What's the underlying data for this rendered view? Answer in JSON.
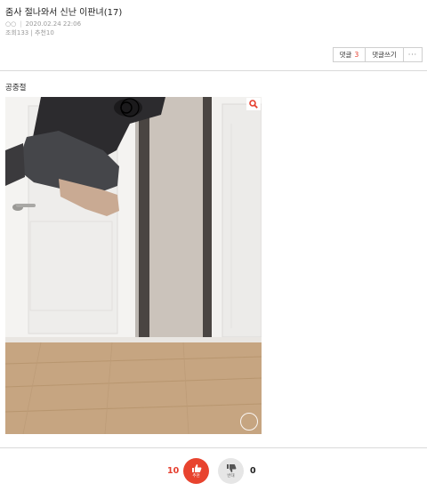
{
  "post": {
    "title": "줌사 절나와서 신난 이판녀(17)",
    "author": "○○",
    "date": "2020.02.24 22:06",
    "stats": "조회133 | 추천10",
    "body_text": "공중절"
  },
  "actions": {
    "comment_label": "댓글",
    "comment_count": "3",
    "write_comment_label": "댓글쓰기",
    "more_label": "···"
  },
  "image": {
    "zoom_icon": "magnifier-icon",
    "overlay_icon": "circle-icon"
  },
  "vote": {
    "up_count": "10",
    "up_label": "추천",
    "down_count": "0",
    "down_label": "반대",
    "up_color": "#e8432e",
    "down_color": "#e6e6e6"
  }
}
